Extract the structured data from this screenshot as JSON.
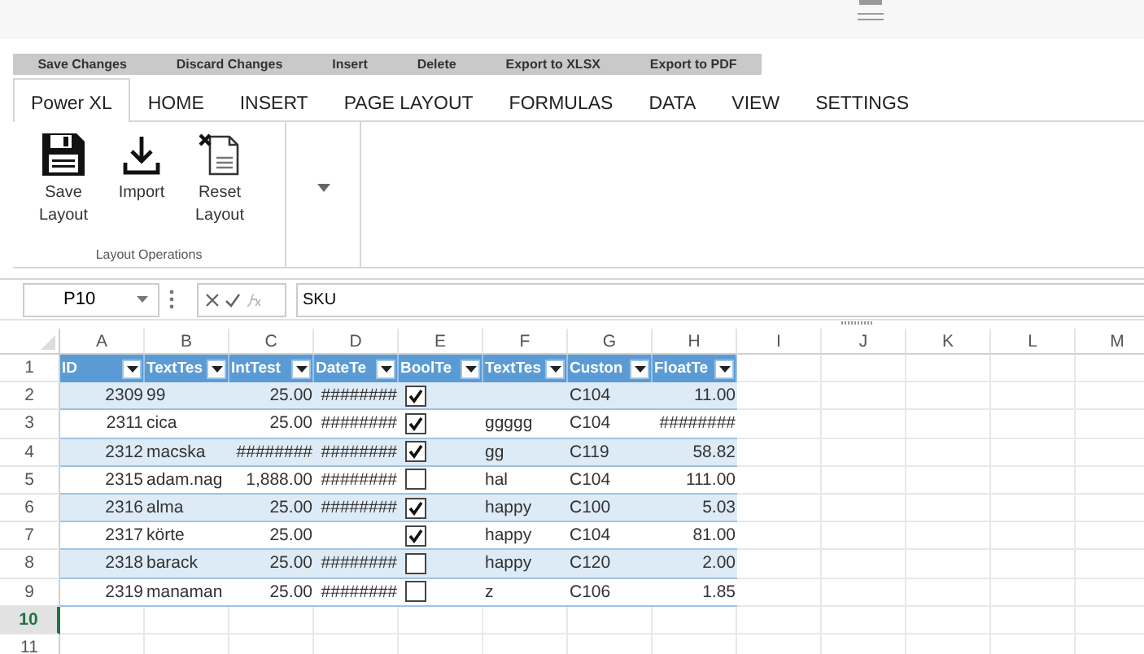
{
  "action_bar": [
    "Save Changes",
    "Discard Changes",
    "Insert",
    "Delete",
    "Export to XLSX",
    "Export to PDF"
  ],
  "tabs": [
    {
      "label": "Power XL",
      "selected": true
    },
    {
      "label": "HOME",
      "selected": false
    },
    {
      "label": "INSERT",
      "selected": false
    },
    {
      "label": "PAGE LAYOUT",
      "selected": false
    },
    {
      "label": "FORMULAS",
      "selected": false
    },
    {
      "label": "DATA",
      "selected": false
    },
    {
      "label": "VIEW",
      "selected": false
    },
    {
      "label": "SETTINGS",
      "selected": false
    }
  ],
  "ribbon_group": {
    "label": "Layout Operations",
    "buttons": [
      {
        "kind": "save",
        "label": "Save Layout"
      },
      {
        "kind": "import",
        "label": "Import"
      },
      {
        "kind": "reset",
        "label": "Reset Layout"
      }
    ]
  },
  "formula_bar": {
    "name_box": "P10",
    "formula": "SKU"
  },
  "column_letters": [
    "A",
    "B",
    "C",
    "D",
    "E",
    "F",
    "G",
    "H",
    "I",
    "J",
    "K",
    "L",
    "M"
  ],
  "table_headers": [
    {
      "label": "ID",
      "kind": "number"
    },
    {
      "label": "TextTes",
      "kind": "text"
    },
    {
      "label": "IntTest",
      "kind": "number"
    },
    {
      "label": "DateTe",
      "kind": "number"
    },
    {
      "label": "BoolTe",
      "kind": "check"
    },
    {
      "label": "TextTes",
      "kind": "text"
    },
    {
      "label": "Custon",
      "kind": "text"
    },
    {
      "label": "FloatTe",
      "kind": "number"
    }
  ],
  "rows": [
    {
      "number": "2",
      "selected": false,
      "cells": [
        "2309",
        "99",
        "25.00",
        "########",
        true,
        null,
        "C104",
        "11.00"
      ]
    },
    {
      "number": "3",
      "selected": false,
      "cells": [
        "2311",
        "cica",
        "25.00",
        "########",
        true,
        "ggggg",
        "C104",
        "########"
      ]
    },
    {
      "number": "4",
      "selected": false,
      "cells": [
        "2312",
        "macska",
        "########",
        "########",
        true,
        "gg",
        "C119",
        "58.82"
      ]
    },
    {
      "number": "5",
      "selected": false,
      "cells": [
        "2315",
        "adam.nag",
        "1,888.00",
        "########",
        false,
        "hal",
        "C104",
        "111.00"
      ]
    },
    {
      "number": "6",
      "selected": false,
      "cells": [
        "2316",
        "alma",
        "25.00",
        "########",
        true,
        "happy",
        "C100",
        "5.03"
      ]
    },
    {
      "number": "7",
      "selected": false,
      "cells": [
        "2317",
        "körte",
        "25.00",
        null,
        true,
        "happy",
        "C104",
        "81.00"
      ]
    },
    {
      "number": "8",
      "selected": false,
      "cells": [
        "2318",
        "barack",
        "25.00",
        "########",
        false,
        "happy",
        "C120",
        "2.00"
      ]
    },
    {
      "number": "9",
      "selected": false,
      "cells": [
        "2319",
        "manaman",
        "25.00",
        "########",
        false,
        "z",
        "C106",
        "1.85"
      ]
    }
  ],
  "header_row_number": "1",
  "empty_rows": [
    {
      "number": "10",
      "selected": true
    },
    {
      "number": "11",
      "selected": false
    }
  ]
}
